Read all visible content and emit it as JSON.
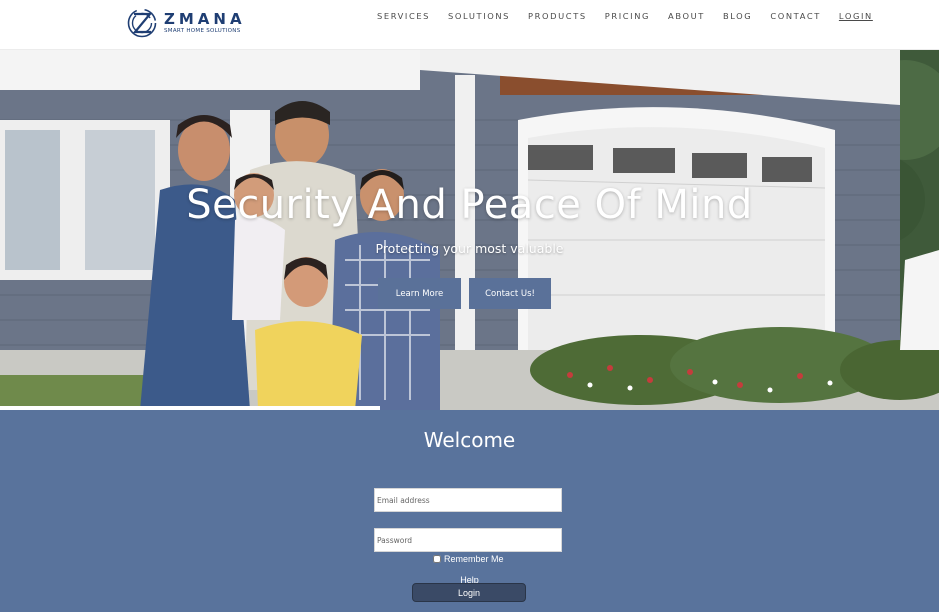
{
  "brand": {
    "name": "ZMANA",
    "tagline": "SMART HOME SOLUTIONS",
    "color": "#1f3e73"
  },
  "nav": [
    {
      "label": "SERVICES"
    },
    {
      "label": "SOLUTIONS"
    },
    {
      "label": "PRODUCTS"
    },
    {
      "label": "PRICING"
    },
    {
      "label": "ABOUT"
    },
    {
      "label": "BLOG"
    },
    {
      "label": "CONTACT"
    },
    {
      "label": "LOGIN"
    }
  ],
  "hero": {
    "title": "Security And Peace Of Mind",
    "subtitle": "Protecting your most valuable",
    "learn_more": "Learn More",
    "contact": "Contact Us!",
    "slide_progress": 0.405,
    "image": "family-in-front-of-house-photo"
  },
  "welcome": {
    "title": "Welcome",
    "email_placeholder": "Email address",
    "password_placeholder": "Password",
    "remember_label": "Remember Me",
    "help_label": "Help",
    "login_label": "Login",
    "background": "#59739c"
  },
  "colors": {
    "button": "#5a7199",
    "login_button": "#3a4a66"
  }
}
